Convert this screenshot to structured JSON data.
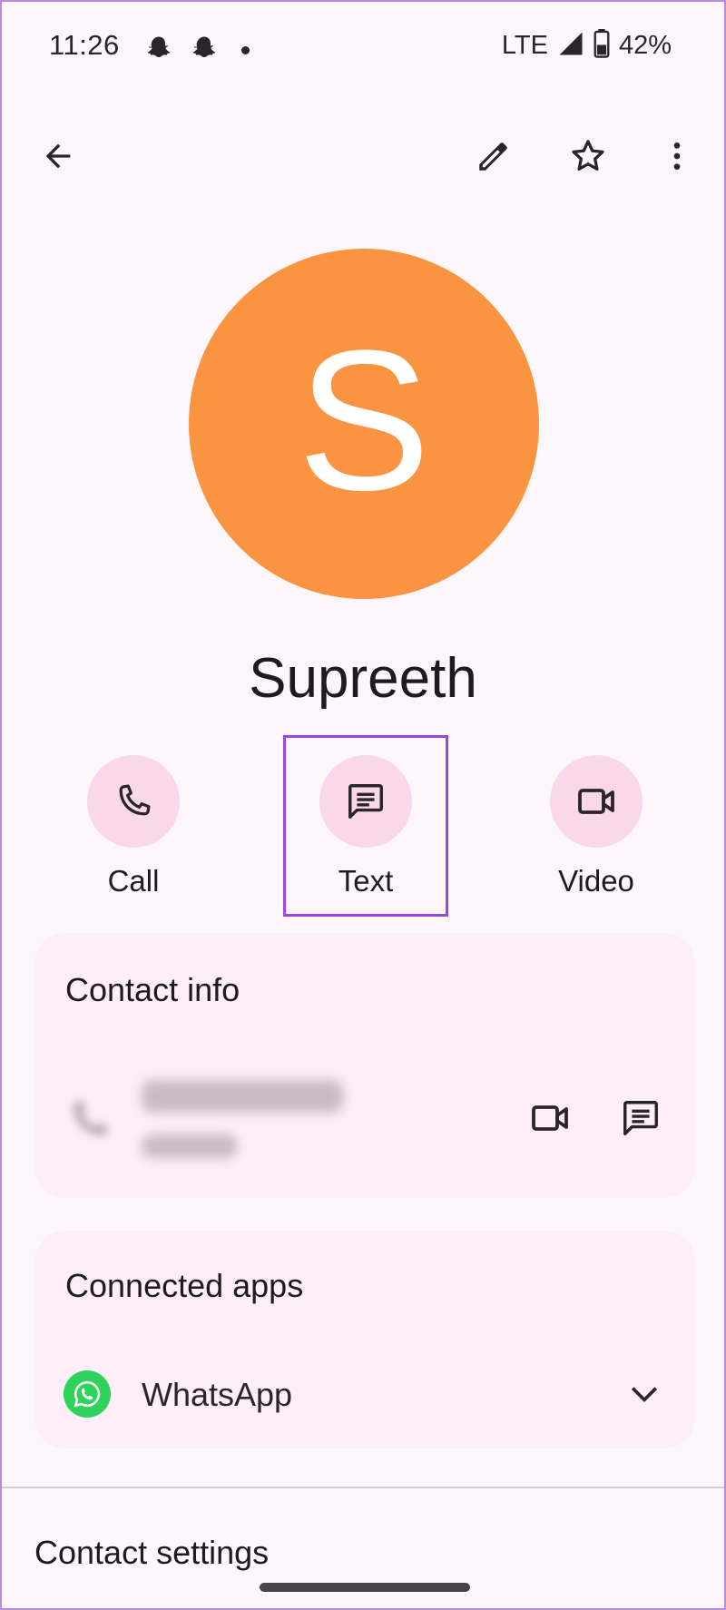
{
  "status_bar": {
    "time": "11:26",
    "network": "LTE",
    "battery": "42%",
    "notification_icons": [
      "snapchat-icon",
      "snapchat-icon",
      "dot"
    ]
  },
  "app_bar": {
    "icons": [
      "back-arrow-icon",
      "edit-pencil-icon",
      "star-outline-icon",
      "more-vert-icon"
    ]
  },
  "avatar": {
    "letter": "S",
    "color": "#fb9440"
  },
  "contact": {
    "name": "Supreeth"
  },
  "actions": [
    {
      "label": "Call",
      "icon": "phone-icon"
    },
    {
      "label": "Text",
      "icon": "message-icon",
      "highlighted": true
    },
    {
      "label": "Video",
      "icon": "videocam-icon"
    }
  ],
  "contact_info": {
    "title": "Contact info",
    "row_icons": [
      "videocam-icon",
      "message-icon"
    ]
  },
  "connected_apps": {
    "title": "Connected apps",
    "apps": [
      {
        "label": "WhatsApp",
        "icon": "whatsapp-icon"
      }
    ]
  },
  "contact_settings": {
    "title": "Contact settings"
  },
  "colors": {
    "accent": "#9b46e2",
    "action_circle": "#fbd7ec",
    "card_bg": "#fdeef8",
    "whatsapp": "#2fd35b"
  }
}
